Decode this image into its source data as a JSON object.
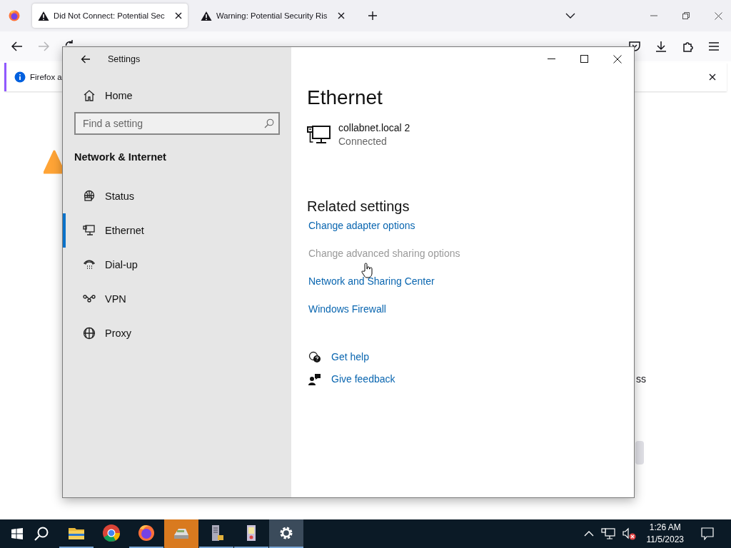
{
  "browser": {
    "tabs": [
      {
        "title": "Did Not Connect: Potential Sec",
        "selected": true
      },
      {
        "title": "Warning: Potential Security Ris",
        "selected": false
      }
    ],
    "notification": "Firefox a",
    "page_fragment": "ss"
  },
  "settings_window": {
    "title": "Settings",
    "home": "Home",
    "search": {
      "placeholder": "Find a setting"
    },
    "section": "Network & Internet",
    "nav": [
      {
        "label": "Status",
        "selected": false
      },
      {
        "label": "Ethernet",
        "selected": true
      },
      {
        "label": "Dial-up",
        "selected": false
      },
      {
        "label": "VPN",
        "selected": false
      },
      {
        "label": "Proxy",
        "selected": false
      }
    ],
    "heading": "Ethernet",
    "connection": {
      "name": "collabnet.local 2",
      "status": "Connected"
    },
    "related_heading": "Related settings",
    "related_links": [
      {
        "label": "Change adapter options",
        "disabled": false
      },
      {
        "label": "Change advanced sharing options",
        "disabled": true
      },
      {
        "label": "Network and Sharing Center",
        "disabled": false
      },
      {
        "label": "Windows Firewall",
        "disabled": false
      }
    ],
    "help_links": [
      {
        "label": "Get help"
      },
      {
        "label": "Give feedback"
      }
    ]
  },
  "taskbar": {
    "apps": [
      {
        "running": true,
        "flashing": false,
        "selected": false
      },
      {
        "running": false,
        "flashing": false,
        "selected": false
      },
      {
        "running": true,
        "flashing": false,
        "selected": false
      },
      {
        "running": false,
        "flashing": true,
        "selected": false
      },
      {
        "running": true,
        "flashing": false,
        "selected": false
      },
      {
        "running": true,
        "flashing": false,
        "selected": false
      },
      {
        "running": true,
        "flashing": false,
        "selected": true
      }
    ],
    "time": "1:26 AM",
    "date": "11/5/2023"
  }
}
